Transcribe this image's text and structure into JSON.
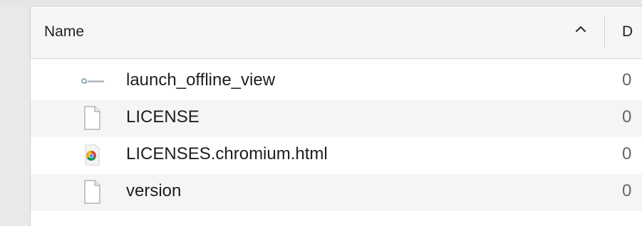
{
  "header": {
    "name_label": "Name",
    "date_label": "D"
  },
  "files": [
    {
      "name": "launch_offline_view",
      "icon": "executable-icon",
      "date": "0"
    },
    {
      "name": "LICENSE",
      "icon": "document-icon",
      "date": "0"
    },
    {
      "name": "LICENSES.chromium.html",
      "icon": "chrome-html-icon",
      "date": "0"
    },
    {
      "name": "version",
      "icon": "document-icon",
      "date": "0"
    }
  ]
}
